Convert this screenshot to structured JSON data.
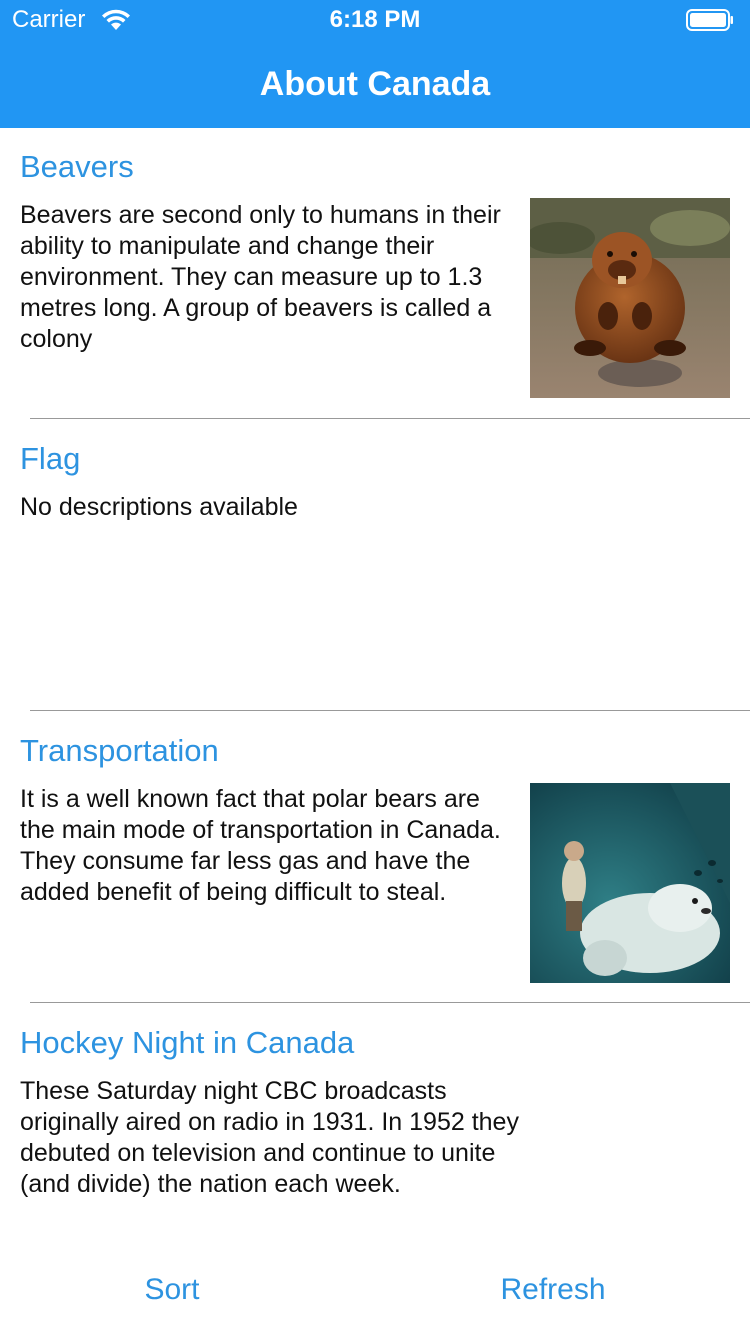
{
  "status_bar": {
    "carrier": "Carrier",
    "time": "6:18 PM",
    "icons": [
      "wifi-icon",
      "battery-icon"
    ]
  },
  "nav": {
    "title": "About Canada"
  },
  "rows": [
    {
      "title": "Beavers",
      "description": "Beavers are second only to humans in their ability to manipulate and change their environment. They can measure up to 1.3 metres long. A group of beavers is called a colony",
      "has_image": true,
      "image_subject": "beaver"
    },
    {
      "title": "Flag",
      "description": "No descriptions available",
      "has_image": false
    },
    {
      "title": "Transportation",
      "description": "It is a well known fact that polar bears are the main mode of transportation in Canada. They consume far less gas and have the added benefit of being difficult to steal.",
      "has_image": true,
      "image_subject": "person riding a polar bear"
    },
    {
      "title": "Hockey Night in Canada",
      "description": "These Saturday night CBC broadcasts originally aired on radio in 1931. In 1952 they debuted on television and continue to unite (and divide) the nation each week.",
      "has_image": false
    }
  ],
  "toolbar": {
    "sort_label": "Sort",
    "refresh_label": "Refresh"
  },
  "colors": {
    "nav_background": "#2196f3",
    "accent": "#2d93e0",
    "separator": "#999999"
  }
}
